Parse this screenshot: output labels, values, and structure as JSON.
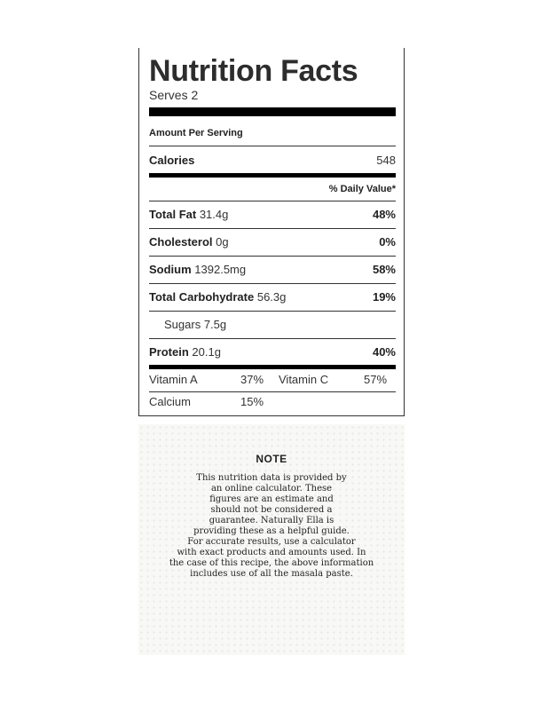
{
  "label": {
    "title": "Nutrition Facts",
    "serves": "Serves 2",
    "amount_per_serving": "Amount Per Serving",
    "calories": {
      "label": "Calories",
      "value": "548"
    },
    "daily_value_header": "% Daily Value*",
    "nutrients": [
      {
        "name": "Total Fat",
        "amount": "31.4g",
        "dv": "48%"
      },
      {
        "name": "Cholesterol",
        "amount": "0g",
        "dv": "0%"
      },
      {
        "name": "Sodium",
        "amount": "1392.5mg",
        "dv": "58%"
      },
      {
        "name": "Total Carbohydrate",
        "amount": "56.3g",
        "dv": "19%"
      },
      {
        "name": "Sugars",
        "amount": "7.5g",
        "dv": ""
      },
      {
        "name": "Protein",
        "amount": "20.1g",
        "dv": "40%"
      }
    ],
    "vitamins": [
      {
        "name": "Vitamin A",
        "dv": "37%"
      },
      {
        "name": "Vitamin C",
        "dv": "57%"
      },
      {
        "name": "Calcium",
        "dv": "15%"
      }
    ]
  },
  "note": {
    "title": "NOTE",
    "lines": [
      "This nutrition data is provided by",
      "an online calculator. These",
      "figures are an estimate and",
      "should not be considered a",
      "guarantee. Naturally Ella is",
      "providing these as a helpful guide.",
      "For accurate results, use a calculator",
      "with exact products and amounts used. In",
      "the case of this recipe, the above information",
      "includes use of all the masala paste."
    ]
  }
}
